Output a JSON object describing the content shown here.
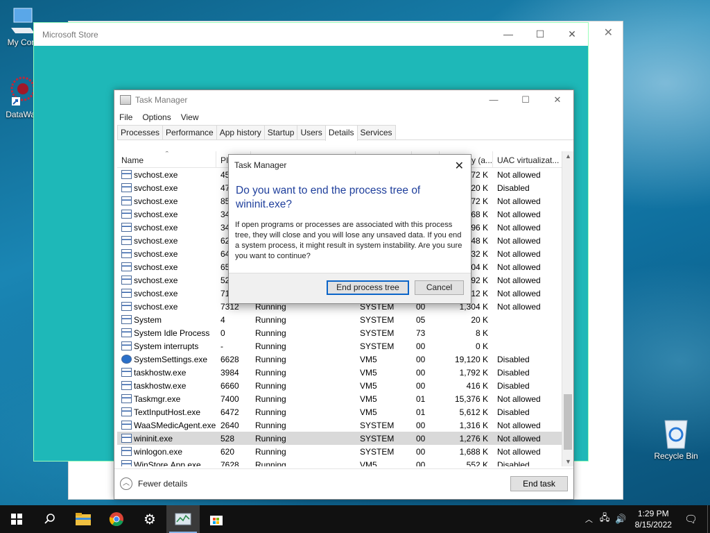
{
  "desktop": {
    "icons": [
      {
        "name": "computer-icon",
        "label": "My Com"
      },
      {
        "name": "datawrangler-icon",
        "label": "DataWag"
      },
      {
        "name": "recycle-bin-icon",
        "label": "Recycle Bin"
      }
    ]
  },
  "store": {
    "title": "Microsoft Store",
    "controls": [
      "—",
      "☐",
      "✕"
    ]
  },
  "taskmanager": {
    "title": "Task Manager",
    "menu": [
      "File",
      "Options",
      "View"
    ],
    "tabs": [
      "Processes",
      "Performance",
      "App history",
      "Startup",
      "Users",
      "Details",
      "Services"
    ],
    "active_tab": "Details",
    "columns": [
      "Name",
      "PI",
      "",
      "",
      "",
      "y (a...",
      "UAC virtualizat..."
    ],
    "rows": [
      [
        "svchost.exe",
        "45",
        "",
        "",
        "",
        "72 K",
        "Not allowed"
      ],
      [
        "svchost.exe",
        "47",
        "",
        "",
        "",
        "20 K",
        "Disabled"
      ],
      [
        "svchost.exe",
        "85",
        "",
        "",
        "",
        "72 K",
        "Not allowed"
      ],
      [
        "svchost.exe",
        "34",
        "",
        "",
        "",
        "68 K",
        "Not allowed"
      ],
      [
        "svchost.exe",
        "34",
        "",
        "",
        "",
        "96 K",
        "Not allowed"
      ],
      [
        "svchost.exe",
        "62",
        "",
        "",
        "",
        "48 K",
        "Not allowed"
      ],
      [
        "svchost.exe",
        "64",
        "",
        "",
        "",
        "32 K",
        "Not allowed"
      ],
      [
        "svchost.exe",
        "65",
        "",
        "",
        "",
        "04 K",
        "Not allowed"
      ],
      [
        "svchost.exe",
        "52",
        "",
        "",
        "",
        "92 K",
        "Not allowed"
      ],
      [
        "svchost.exe",
        "71",
        "",
        "",
        "",
        "12 K",
        "Not allowed"
      ],
      [
        "svchost.exe",
        "7312",
        "Running",
        "SYSTEM",
        "00",
        "1,304 K",
        "Not allowed"
      ],
      [
        "System",
        "4",
        "Running",
        "SYSTEM",
        "05",
        "20 K",
        ""
      ],
      [
        "System Idle Process",
        "0",
        "Running",
        "SYSTEM",
        "73",
        "8 K",
        ""
      ],
      [
        "System interrupts",
        "-",
        "Running",
        "SYSTEM",
        "00",
        "0 K",
        ""
      ],
      [
        "SystemSettings.exe",
        "6628",
        "Running",
        "VM5",
        "00",
        "19,120 K",
        "Disabled"
      ],
      [
        "taskhostw.exe",
        "3984",
        "Running",
        "VM5",
        "00",
        "1,792 K",
        "Disabled"
      ],
      [
        "taskhostw.exe",
        "6660",
        "Running",
        "VM5",
        "00",
        "416 K",
        "Disabled"
      ],
      [
        "Taskmgr.exe",
        "7400",
        "Running",
        "VM5",
        "01",
        "15,376 K",
        "Not allowed"
      ],
      [
        "TextInputHost.exe",
        "6472",
        "Running",
        "VM5",
        "01",
        "5,612 K",
        "Disabled"
      ],
      [
        "WaaSMedicAgent.exe",
        "2640",
        "Running",
        "SYSTEM",
        "00",
        "1,316 K",
        "Not allowed"
      ],
      [
        "wininit.exe",
        "528",
        "Running",
        "SYSTEM",
        "00",
        "1,276 K",
        "Not allowed"
      ],
      [
        "winlogon.exe",
        "620",
        "Running",
        "SYSTEM",
        "00",
        "1,688 K",
        "Not allowed"
      ],
      [
        "WinStore.App.exe",
        "7628",
        "Running",
        "VM5",
        "00",
        "552 K",
        "Disabled"
      ]
    ],
    "selected_row": "wininit.exe",
    "fewer_details": "Fewer details",
    "end_task": "End task"
  },
  "dialog": {
    "title": "Task Manager",
    "question": "Do you want to end the process tree of wininit.exe?",
    "body": "If open programs or processes are associated with this process tree, they will close and you will lose any unsaved data. If you end a system process, it might result in system instability. Are you sure you want to continue?",
    "confirm": "End process tree",
    "cancel": "Cancel"
  },
  "taskbar": {
    "time": "1:29 PM",
    "date": "8/15/2022"
  }
}
